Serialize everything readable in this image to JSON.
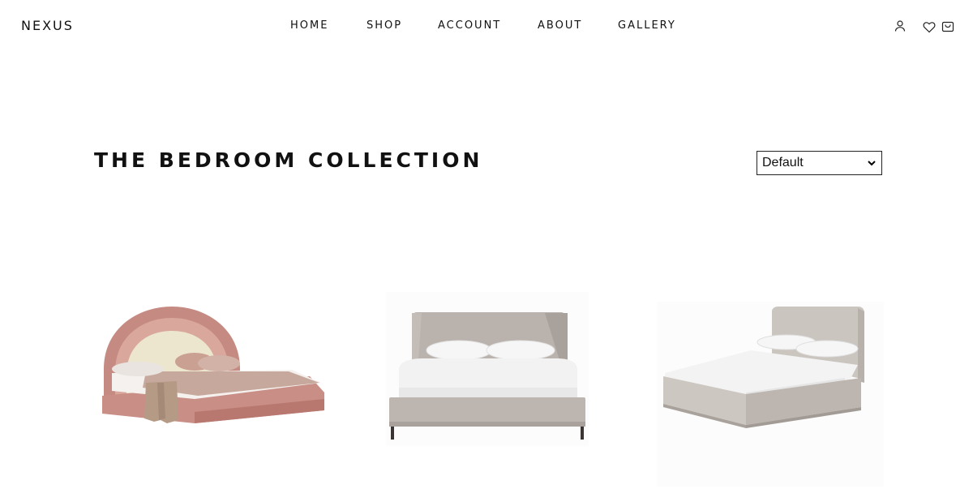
{
  "brand": {
    "name": "NEXUS"
  },
  "nav": {
    "home": "HOME",
    "shop": "SHOP",
    "account": "ACCOUNT",
    "about": "ABOUT",
    "gallery": "GALLERY"
  },
  "header_icons": [
    "user-icon",
    "heart-icon",
    "cart-icon"
  ],
  "collection": {
    "title": "THE BEDROOM COLLECTION"
  },
  "sort": {
    "selected": "Default"
  },
  "products": [
    {
      "image": "arched-headboard-bed",
      "colors": [
        "#c98e86",
        "#e8e0c8",
        "#b59a86"
      ]
    },
    {
      "image": "winged-upholstered-bed",
      "colors": [
        "#b8b0ab",
        "#f2f2f2"
      ]
    },
    {
      "image": "upholstered-storage-bed",
      "colors": [
        "#c8c2bc",
        "#f5f5f5"
      ]
    }
  ]
}
